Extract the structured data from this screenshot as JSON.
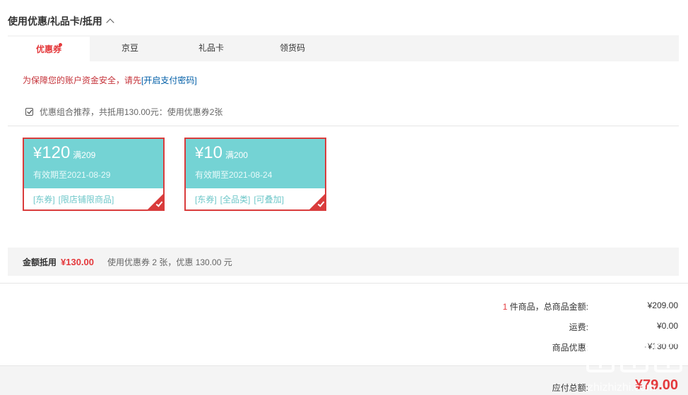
{
  "section": {
    "title": "使用优惠/礼品卡/抵用"
  },
  "tabs": [
    {
      "label": "优惠券",
      "active": true,
      "has_dot": true
    },
    {
      "label": "京豆"
    },
    {
      "label": "礼品卡"
    },
    {
      "label": "领货码"
    }
  ],
  "security": {
    "message": "为保障您的账户资金安全，请先",
    "link": "[开启支付密码]"
  },
  "combo": {
    "checked": true,
    "text": "优惠组合推荐，共抵用130.00元：使用优惠券2张"
  },
  "coupons": [
    {
      "yen": "¥",
      "amount": "120",
      "condition": "满209",
      "valid": "有效期至2021-08-29",
      "tags": [
        "[东券]",
        "[限店铺限商品]"
      ],
      "selected": true
    },
    {
      "yen": "¥",
      "amount": "10",
      "condition": "满200",
      "valid": "有效期至2021-08-24",
      "tags": [
        "[东券]",
        "[全品类]",
        "[可叠加]"
      ],
      "selected": true
    }
  ],
  "summary": {
    "label": "金额抵用",
    "amount": "¥130.00",
    "desc": "使用优惠券 2 张，优惠 130.00 元"
  },
  "totals": {
    "count": "1",
    "goods_label": " 件商品，总商品金额:",
    "goods_value": "¥209.00",
    "freight_label": "运费:",
    "freight_value": "¥0.00",
    "discount_label": "商品优惠:",
    "discount_value": "-¥130.00"
  },
  "payable": {
    "label": "应付总额:",
    "value": "¥79.00"
  },
  "watermark": {
    "text": "什么值得买",
    "url_text": "zhizhizhi.com"
  },
  "colors": {
    "accent": "#e4393c",
    "coupon_bg": "#74d3d4",
    "coupon_border": "#d93c3c",
    "link": "#005ea7"
  }
}
